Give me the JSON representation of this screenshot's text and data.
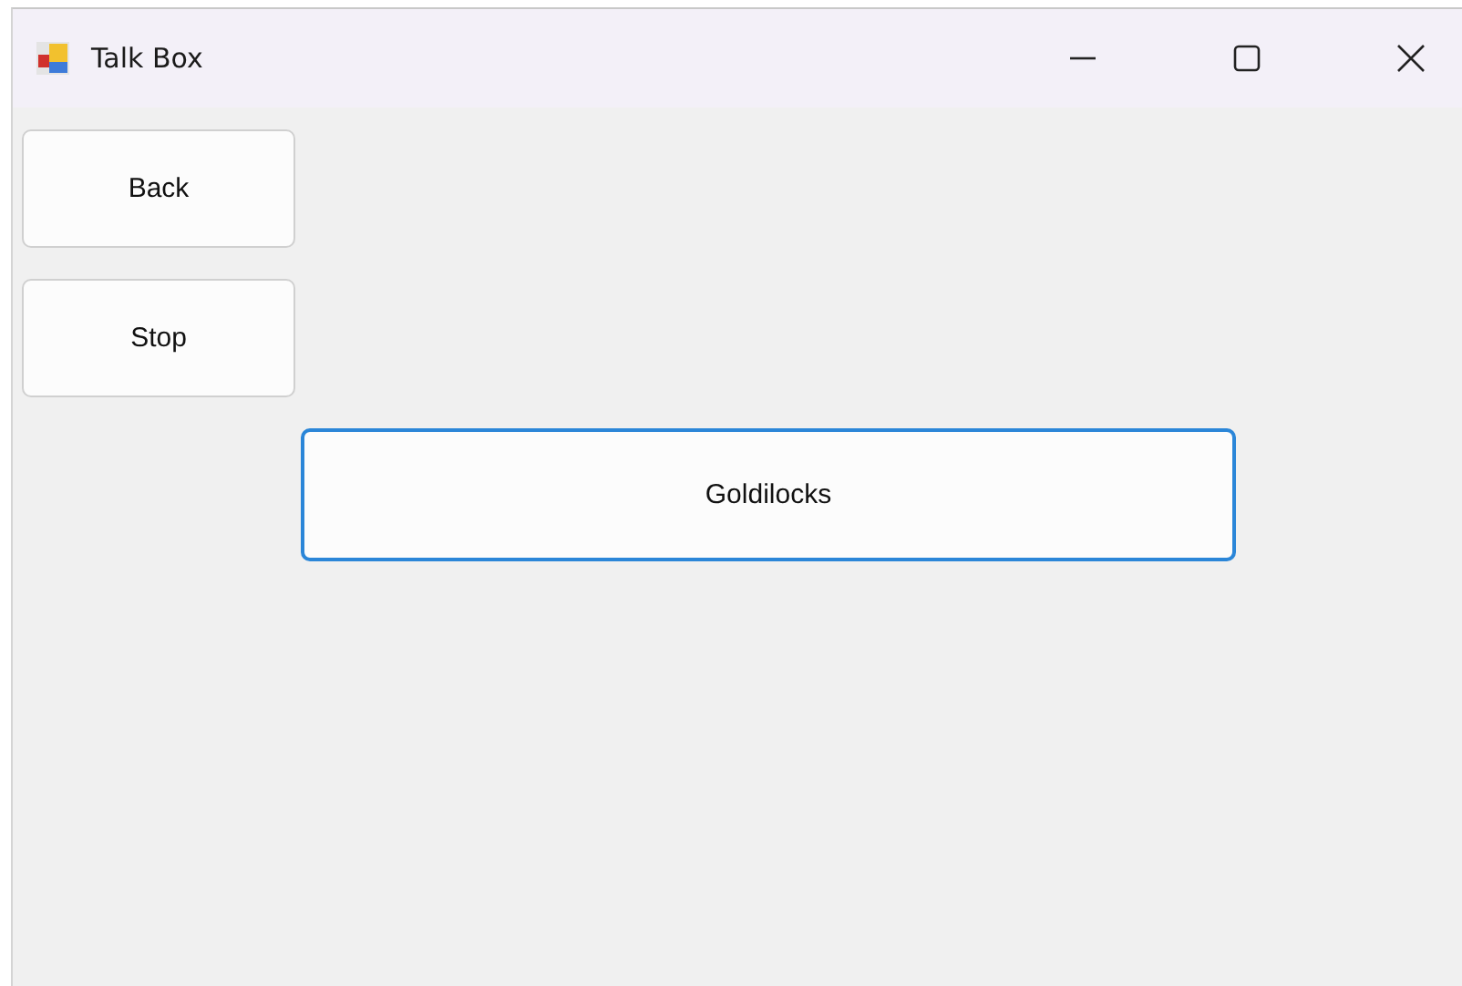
{
  "window": {
    "title": "Talk Box"
  },
  "buttons": [
    {
      "label": "Back",
      "kind": "small",
      "focused": false
    },
    {
      "label": "Stop",
      "kind": "small",
      "focused": false
    },
    {
      "label": "Goldilocks",
      "kind": "wide",
      "focused": true
    }
  ]
}
